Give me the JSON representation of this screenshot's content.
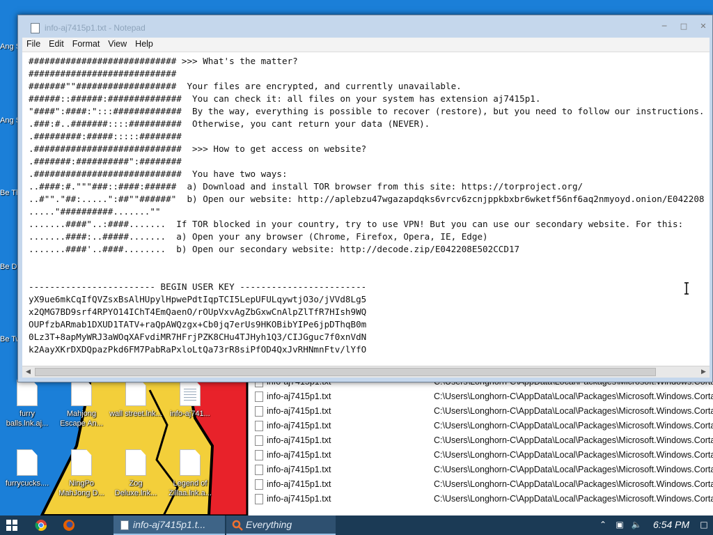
{
  "notepad": {
    "title": "info-aj7415p1.txt - Notepad",
    "menu": [
      "File",
      "Edit",
      "Format",
      "View",
      "Help"
    ],
    "lines": [
      "############################ >>> What's the matter?",
      "############################",
      "#######\"\"###################  Your files are encrypted, and currently unavailable.",
      "######::######:##############  You can check it: all files on your system has extension aj7415p1.",
      "\"####\":####:\":::#############  By the way, everything is possible to recover (restore), but you need to follow our instructions.",
      ".###:#..#######::::##########  Otherwise, you cant return your data (NEVER).",
      ".#########:#####:::::########",
      ".############################  >>> How to get access on website?",
      ".#######:##########\":########",
      ".############################  You have two ways:",
      "..####:#.\"\"\"###::####:######  a) Download and install TOR browser from this site: https://torproject.org/",
      "..#\"\".\"##:.....\":##\"\"######\"  b) Open our website: http://aplebzu47wgazapdqks6vrcv6zcnjppkbxbr6wketf56nf6aq2nmyoyd.onion/E042208",
      ".....\"##########.......\"\"",
      ".......####\"..:####.......  If TOR blocked in your country, try to use VPN! But you can use our secondary website. For this:",
      ".......####:..#####.......  a) Open your any browser (Chrome, Firefox, Opera, IE, Edge)",
      ".......####'..####........  b) Open our secondary website: http://decode.zip/E042208E502CCD17",
      "",
      "",
      "------------------------ BEGIN USER KEY ------------------------",
      "yX9ue6mkCqIfQVZsxBsAlHUpylHpwePdtIqpTCI5LepUFULqywtjO3o/jVVd8Lg5",
      "x2QMG7BD9srf4RPYO14IChT4EmQaenO/rOUpVxvAgZbGxwCnAlpZlTfR7HIsh9WQ",
      "OUPfzbARmab1DXUD1TATV+raQpAWQzgx+Cb0jq7erUs9HKOBibYIPe6jpDThqB0m",
      "0Lz3T+8apMyWRJ3aWOqXAFvdiMR7HFrjPZK8CHu4TJHyh1Q3/CIJGguc7f0xnVdN",
      "k2AayXKrDXDQpazPkd6FM7PabRaPxloLtQa73rR8siPfOD4QxJvRHNmnFtv/lYfO"
    ]
  },
  "desktop_icons": [
    {
      "label": "furry balls.lnk.aj..."
    },
    {
      "label": "Mahjong Escape An..."
    },
    {
      "label": "wall street.lnk..."
    },
    {
      "label": "info-aj741..."
    },
    {
      "label": "furrycucks...."
    },
    {
      "label": "NingPo MahJong D..."
    },
    {
      "label": "Zog Deluxe.lnk..."
    },
    {
      "label": "Legend of Zillaa.lnk.a..."
    }
  ],
  "left_peek_labels": [
    "Ang Soy",
    "Ang Soy",
    "Be The",
    "Be Delu",
    "Be Twis"
  ],
  "file_list": {
    "rows": [
      {
        "name": "info-aj7415p1.txt",
        "path": "C:\\Users\\Longhorn-C\\AppData\\Local\\Packages\\Microsoft.Windows.Corta"
      },
      {
        "name": "info-aj7415p1.txt",
        "path": "C:\\Users\\Longhorn-C\\AppData\\Local\\Packages\\Microsoft.Windows.Corta"
      },
      {
        "name": "info-aj7415p1.txt",
        "path": "C:\\Users\\Longhorn-C\\AppData\\Local\\Packages\\Microsoft.Windows.Corta"
      },
      {
        "name": "info-aj7415p1.txt",
        "path": "C:\\Users\\Longhorn-C\\AppData\\Local\\Packages\\Microsoft.Windows.Corta"
      },
      {
        "name": "info-aj7415p1.txt",
        "path": "C:\\Users\\Longhorn-C\\AppData\\Local\\Packages\\Microsoft.Windows.Corta"
      },
      {
        "name": "info-aj7415p1.txt",
        "path": "C:\\Users\\Longhorn-C\\AppData\\Local\\Packages\\Microsoft.Windows.Corta"
      },
      {
        "name": "info-aj7415p1.txt",
        "path": "C:\\Users\\Longhorn-C\\AppData\\Local\\Packages\\Microsoft.Windows.Corta"
      },
      {
        "name": "info-aj7415p1.txt",
        "path": "C:\\Users\\Longhorn-C\\AppData\\Local\\Packages\\Microsoft.Windows.Corta"
      },
      {
        "name": "info-aj7415p1.txt",
        "path": "C:\\Users\\Longhorn-C\\AppData\\Local\\Packages\\Microsoft.Windows.Corta"
      }
    ]
  },
  "taskbar": {
    "notepad_label": "info-aj7415p1.t...",
    "everything_label": "Everything",
    "clock": "6:54 PM"
  },
  "colors": {
    "desktop": "#1b7fd8",
    "taskbar": "#1b3a55",
    "titlebar": "#c5d7ec"
  },
  "icons": [
    "windows-start-icon",
    "chrome-icon",
    "firefox-icon",
    "notepad-icon",
    "everything-icon",
    "volume-icon",
    "network-icon",
    "action-center-icon"
  ]
}
